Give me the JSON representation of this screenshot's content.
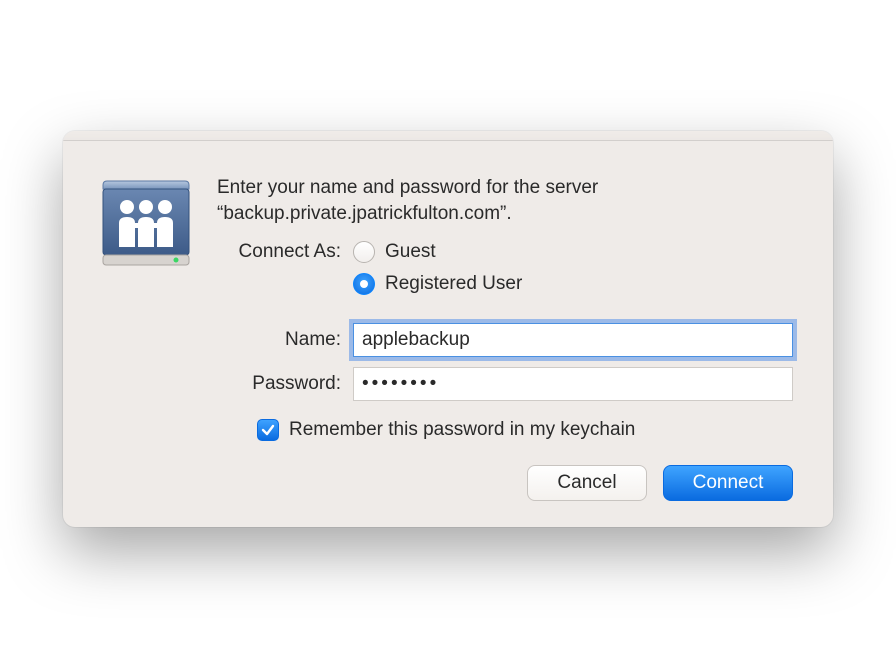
{
  "prompt": {
    "line1": "Enter your name and password for the server",
    "line2": "“backup.private.jpatrickfulton.com”."
  },
  "connectAs": {
    "label": "Connect As:",
    "options": {
      "guest": "Guest",
      "registered": "Registered User"
    },
    "selected": "registered"
  },
  "fields": {
    "nameLabel": "Name:",
    "nameValue": "applebackup",
    "passwordLabel": "Password:",
    "passwordValue": "••••••••"
  },
  "remember": {
    "checked": true,
    "label": "Remember this password in my keychain"
  },
  "buttons": {
    "cancel": "Cancel",
    "connect": "Connect"
  }
}
